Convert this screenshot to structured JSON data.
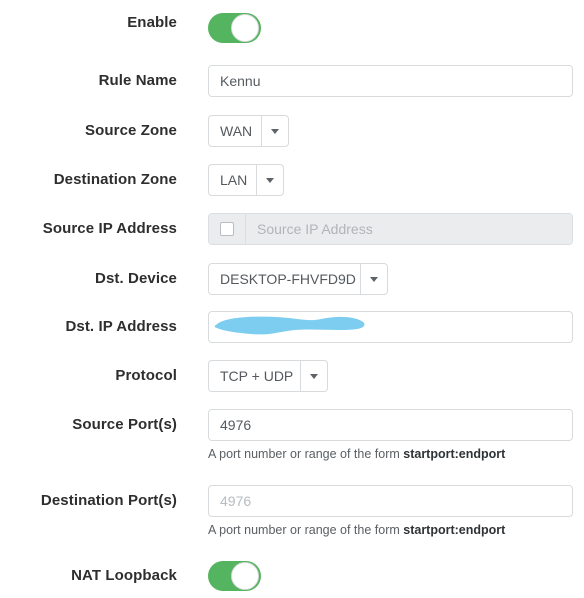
{
  "form": {
    "rows": [
      {
        "id": "enable",
        "label": "Enable",
        "type": "toggle",
        "state": "on"
      },
      {
        "id": "rule-name",
        "label": "Rule Name",
        "type": "text",
        "value": "Kennu",
        "placeholder": "Rule Name"
      },
      {
        "id": "source-zone",
        "label": "Source Zone",
        "type": "select",
        "value": "WAN"
      },
      {
        "id": "destination-zone",
        "label": "Destination Zone",
        "type": "select",
        "value": "LAN"
      },
      {
        "id": "source-ip-address",
        "label": "Source IP Address",
        "type": "checkbox-text-disabled",
        "placeholder": "Source IP Address",
        "checked": "false"
      },
      {
        "id": "dst-device",
        "label": "Dst. Device",
        "type": "select",
        "value": "DESKTOP-FHVFD9D"
      },
      {
        "id": "dst-ip-address",
        "label": "Dst. IP Address",
        "type": "text-redacted",
        "value": "",
        "placeholder": "Dst. IP Address"
      },
      {
        "id": "protocol",
        "label": "Protocol",
        "type": "select",
        "value": "TCP + UDP"
      },
      {
        "id": "source-ports",
        "label": "Source Port(s)",
        "type": "text-with-help",
        "value": "4976",
        "placeholder": "Source Port(s)",
        "help_prefix": "A port number or range of the form ",
        "help_bold": "startport:endport"
      },
      {
        "id": "destination-ports",
        "label": "Destination Port(s)",
        "type": "text-with-help-placeholder",
        "value": "",
        "placeholder": "4976",
        "help_prefix": "A port number or range of the form ",
        "help_bold": "startport:endport"
      },
      {
        "id": "nat-loopback",
        "label": "NAT Loopback",
        "type": "toggle",
        "state": "on"
      }
    ]
  },
  "icons": {
    "caret": "chevron-down-icon",
    "checkbox": "checkbox-unchecked-icon"
  },
  "colors": {
    "toggle_on": "#54b45f",
    "redaction": "#7ccdef",
    "border": "#d8dbdd",
    "disabled_bg": "#ebecee",
    "label_text": "#2e2e2e",
    "placeholder_text": "#b6bcc1"
  }
}
